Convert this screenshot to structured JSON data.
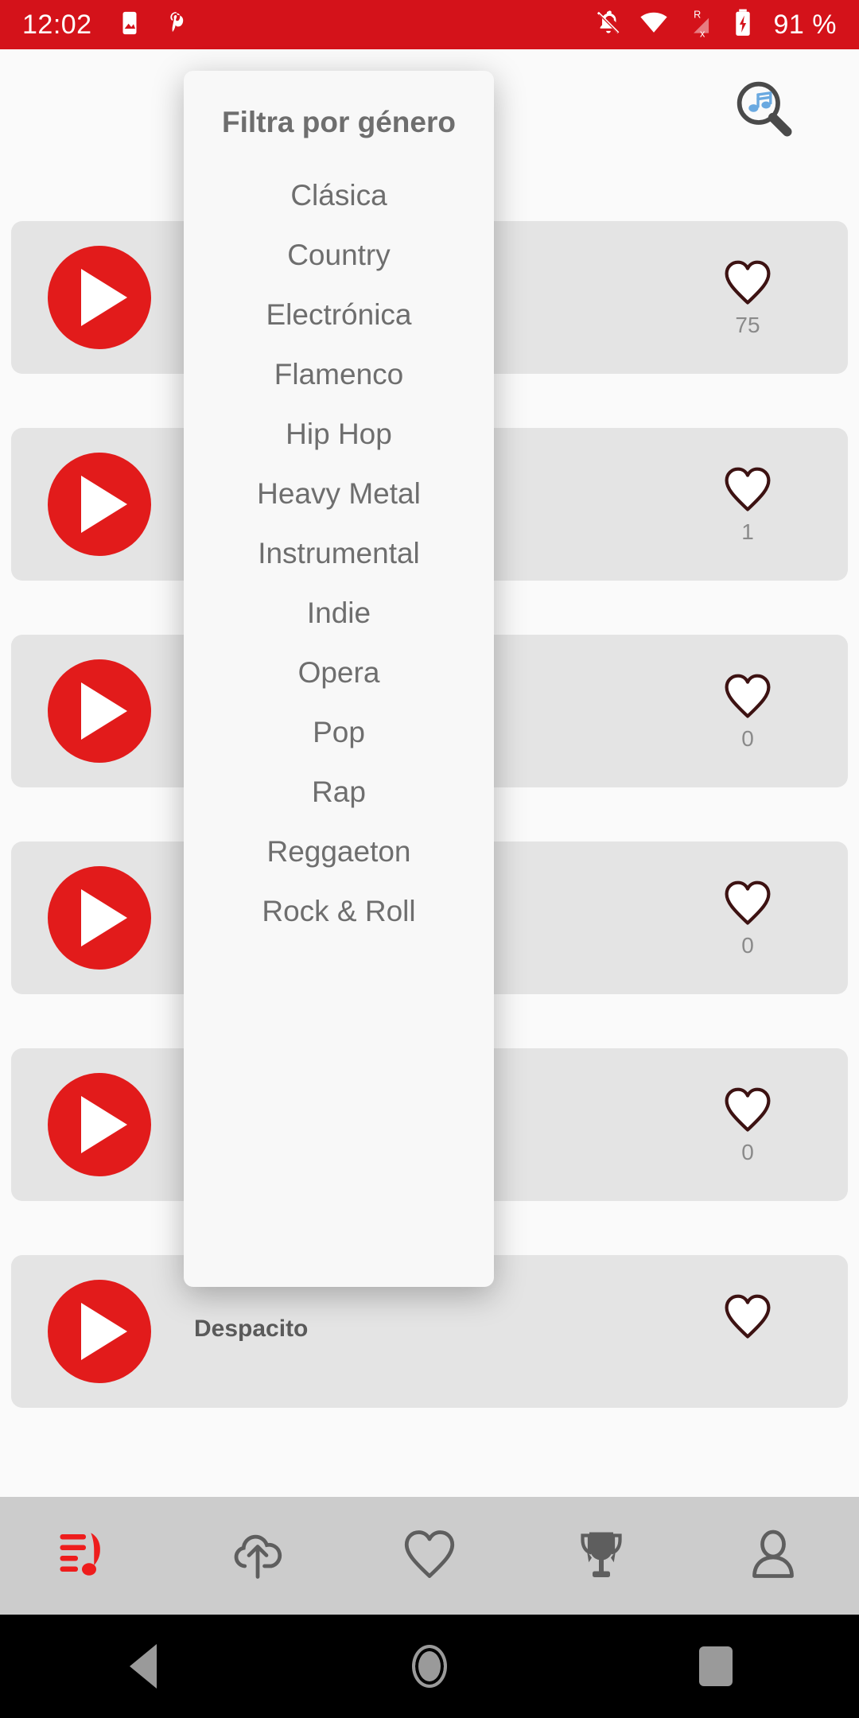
{
  "status_bar": {
    "clock": "12:02",
    "battery_percent": "91 %",
    "bg_color": "#d4121a",
    "left_icons": [
      "image-icon",
      "pinterest-icon"
    ],
    "right_icons": [
      "notifications-off-icon",
      "wifi-icon",
      "cellular-roaming-no-signal-icon",
      "battery-charging-icon"
    ]
  },
  "app_bar": {
    "search_icon": "music-search-icon"
  },
  "songs": [
    {
      "title": "",
      "likes": "75"
    },
    {
      "title": "",
      "likes": "1"
    },
    {
      "title": "",
      "likes": "0"
    },
    {
      "title": "",
      "likes": "0"
    },
    {
      "title": "",
      "likes": "0"
    },
    {
      "title": "Despacito",
      "likes": ""
    }
  ],
  "dialog": {
    "title": "Filtra por género",
    "genres": [
      "Clásica",
      "Country",
      "Electrónica",
      "Flamenco",
      "Hip Hop",
      "Heavy Metal",
      "Instrumental",
      "Indie",
      "Opera",
      "Pop",
      "Rap",
      "Reggaeton",
      "Rock & Roll"
    ]
  },
  "bottom_nav": {
    "items": [
      {
        "name": "songs",
        "icon": "music-playlist-icon",
        "active": true
      },
      {
        "name": "upload",
        "icon": "cloud-upload-icon",
        "active": false
      },
      {
        "name": "favorites",
        "icon": "heart-icon",
        "active": false
      },
      {
        "name": "ranking",
        "icon": "trophy-icon",
        "active": false
      },
      {
        "name": "profile",
        "icon": "person-icon",
        "active": false
      }
    ],
    "active_color": "#ee1c1c",
    "inactive_color": "#5e5e5e",
    "bg_color": "#cccccc"
  },
  "android_nav": {
    "buttons": [
      "back-icon",
      "home-icon",
      "recents-icon"
    ]
  },
  "colors": {
    "accent_red": "#e21b1b",
    "card_gray": "#e4e4e4",
    "text_gray": "#6e6e6e",
    "heart_stroke": "#3d1212"
  }
}
